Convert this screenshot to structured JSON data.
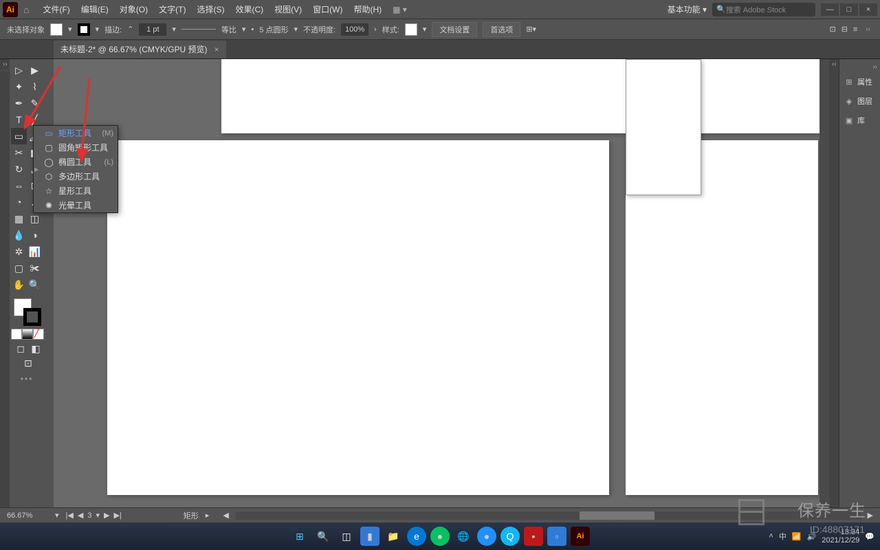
{
  "menubar": {
    "items": [
      {
        "label": "文件(F)"
      },
      {
        "label": "编辑(E)"
      },
      {
        "label": "对象(O)"
      },
      {
        "label": "文字(T)"
      },
      {
        "label": "选择(S)"
      },
      {
        "label": "效果(C)"
      },
      {
        "label": "视图(V)"
      },
      {
        "label": "窗口(W)"
      },
      {
        "label": "帮助(H)"
      }
    ]
  },
  "workspace": {
    "label": "基本功能",
    "search_placeholder": "搜索 Adobe Stock"
  },
  "win_controls": {
    "min": "—",
    "max": "□",
    "close": "×"
  },
  "options": {
    "no_selection": "未选择对象",
    "stroke_label": "描边:",
    "stroke_val": "1 pt",
    "uniform_label": "等比",
    "brush_label": "5 点圆形",
    "opacity_label": "不透明度:",
    "opacity_val": "100%",
    "style_label": "样式:",
    "doc_setup": "文档设置",
    "prefs": "首选项"
  },
  "document": {
    "tab_title": "未标题-2* @ 66.67% (CMYK/GPU 预览)"
  },
  "flyout": {
    "items": [
      {
        "label": "矩形工具",
        "shortcut": "(M)",
        "selected": true,
        "icon": "rect"
      },
      {
        "label": "圆角矩形工具",
        "shortcut": "",
        "icon": "roundrect"
      },
      {
        "label": "椭圆工具",
        "shortcut": "(L)",
        "icon": "ellipse"
      },
      {
        "label": "多边形工具",
        "shortcut": "",
        "icon": "polygon"
      },
      {
        "label": "星形工具",
        "shortcut": "",
        "icon": "star"
      },
      {
        "label": "光晕工具",
        "shortcut": "",
        "icon": "flare"
      }
    ]
  },
  "panels": {
    "items": [
      {
        "label": "属性"
      },
      {
        "label": "图层"
      },
      {
        "label": "库"
      }
    ]
  },
  "status": {
    "zoom": "66.67%",
    "artboard": "3",
    "tool": "矩形"
  },
  "taskbar": {
    "time": "13:34",
    "date": "2021/12/29",
    "lang": "中"
  },
  "watermark": {
    "brand": "保养一生",
    "id": "ID:48807171"
  }
}
